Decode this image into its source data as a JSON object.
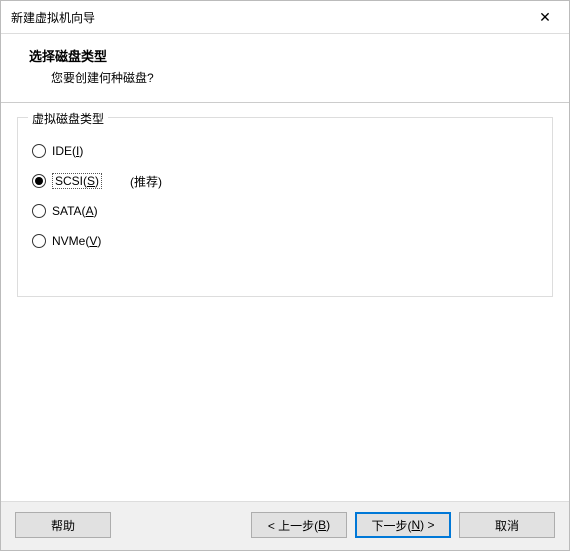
{
  "titlebar": {
    "title": "新建虚拟机向导"
  },
  "header": {
    "title": "选择磁盘类型",
    "subtitle": "您要创建何种磁盘?"
  },
  "group": {
    "label": "虚拟磁盘类型",
    "options": [
      {
        "prefix": "IDE(",
        "accel": "I",
        "suffix": ")",
        "selected": false,
        "recommended": ""
      },
      {
        "prefix": "SCSI(",
        "accel": "S",
        "suffix": ")",
        "selected": true,
        "recommended": "(推荐)"
      },
      {
        "prefix": "SATA(",
        "accel": "A",
        "suffix": ")",
        "selected": false,
        "recommended": ""
      },
      {
        "prefix": "NVMe(",
        "accel": "V",
        "suffix": ")",
        "selected": false,
        "recommended": ""
      }
    ]
  },
  "footer": {
    "help": "帮助",
    "back_p": "< 上一步(",
    "back_a": "B",
    "back_s": ")",
    "next_p": "下一步(",
    "next_a": "N",
    "next_s": ") >",
    "cancel": "取消"
  }
}
